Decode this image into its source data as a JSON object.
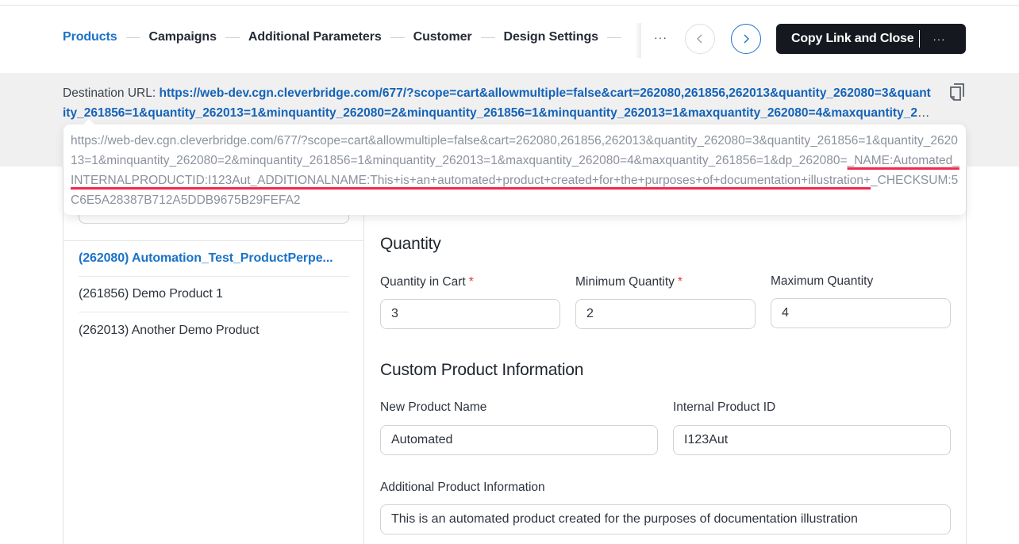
{
  "header": {
    "steps": [
      {
        "label": "Products",
        "active": true
      },
      {
        "label": "Campaigns",
        "active": false
      },
      {
        "label": "Additional Parameters",
        "active": false
      },
      {
        "label": "Customer",
        "active": false
      },
      {
        "label": "Design Settings",
        "active": false
      }
    ],
    "more_steps_label": "···",
    "prev_icon": "chevron-left-icon",
    "next_icon": "chevron-right-icon",
    "copy_button_label": "Copy Link and Close",
    "copy_button_more_label": "···"
  },
  "destination": {
    "label": "Destination URL: ",
    "url": "https://web-dev.cgn.cleverbridge.com/677/?scope=cart&allowmultiple=false&cart=262080,261856,262013&quantity_262080=3&quantity_261856=1&quantity_262013=1&minquantity_262080=2&minquantity_261856=1&minquantity_262013=1&maxquantity_262080=4&maxquantity_261856=1&dp_262080=_NAME:Automated_INTERNALPRODUCTID:I123Aut_ADDITIONALNAME:This+is+an+automated+product+created+for+the+purposes+of+documentation+illustration+_CHECKSUM:5C6E5A28387B712A5DDB9675B29FEFA2",
    "copy_icon": "copy-icon"
  },
  "tooltip": {
    "url_before": "https://web-dev.cgn.cleverbridge.com/677/?scope=cart&allowmultiple=false&cart=262080,261856,262013&quantity_262080=3&quantity_261856=1&quantity_262013=1&minquantity_262080=2&minquantity_261856=1&minquantity_262013=1&maxquantity_262080=4&maxquantity_261856=1&dp_262080=",
    "url_highlighted": "_NAME:Automated_INTERNALPRODUCTID:I123Aut_ADDITIONALNAME:This+is+an+automated+product+created+for+the+purposes+of+documentation+illustration+",
    "url_after": "_CHECKSUM:5C6E5A28387B712A5DDB9675B29FEFA2",
    "highlight_color": "#f2284f"
  },
  "products": [
    {
      "label": "(262080) Automation_Test_ProductPerpe...",
      "active": true
    },
    {
      "label": "(261856) Demo Product 1",
      "active": false
    },
    {
      "label": "(262013) Another Demo Product",
      "active": false
    }
  ],
  "quantity": {
    "title": "Quantity",
    "cart_label": "Quantity in Cart",
    "cart_value": "3",
    "min_label": "Minimum Quantity",
    "min_value": "2",
    "max_label": "Maximum Quantity",
    "max_value": "4",
    "required_marker": "*"
  },
  "custom_info": {
    "title": "Custom Product Information",
    "name_label": "New Product Name",
    "name_value": "Automated",
    "id_label": "Internal Product ID",
    "id_value": "I123Aut",
    "additional_label": "Additional Product Information",
    "additional_value": "This is an automated product created for the purposes of documentation illustration"
  },
  "colors": {
    "accent": "#1a73c8",
    "dark_button": "#15191f",
    "required": "#e5363d"
  }
}
